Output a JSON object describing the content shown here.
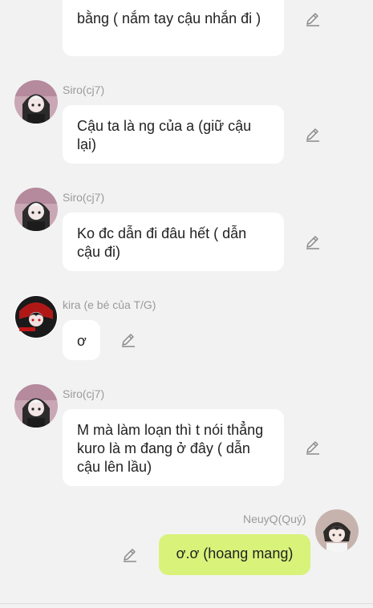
{
  "colors": {
    "background": "#f2f2f2",
    "bubble_other": "#ffffff",
    "bubble_self": "#d8f27a",
    "sender_name": "#9a9a9a"
  },
  "messages": [
    {
      "sender": "",
      "text": "bằng ( nắm tay cậu nhắn đi )",
      "self": false,
      "icon": "pencil-icon"
    },
    {
      "sender": "Siro(cj7)",
      "text": "Cậu ta là ng của a (giữ cậu lại)",
      "self": false,
      "icon": "pencil-icon"
    },
    {
      "sender": "Siro(cj7)",
      "text": "Ko đc dẫn đi đâu hết ( dẫn cậu đi)",
      "self": false,
      "icon": "pencil-icon"
    },
    {
      "sender": "kira (e bé của T/G)",
      "text": "ơ",
      "self": false,
      "icon": "pencil-icon"
    },
    {
      "sender": "Siro(cj7)",
      "text": "M mà làm loạn thì t nói thẳng kuro là m đang ở đây ( dẫn cậu lên lầu)",
      "self": false,
      "icon": "pencil-icon"
    },
    {
      "sender": "NeuyQ(Quý)",
      "text": "ơ.ơ (hoang mang)",
      "self": true,
      "icon": "pencil-icon"
    }
  ]
}
